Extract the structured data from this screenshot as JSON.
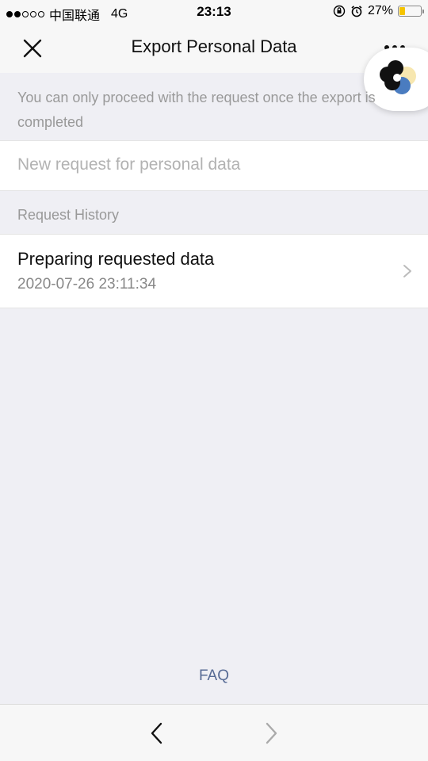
{
  "status_bar": {
    "carrier": "中国联通",
    "network": "4G",
    "time": "23:13",
    "battery_percent": "27%",
    "battery_level": 0.27,
    "battery_color": "#f5c400",
    "signal_bars_filled": 2,
    "signal_bars_total": 5
  },
  "nav": {
    "title": "Export Personal Data",
    "close_icon": "close-icon",
    "more_icon": "more-icon"
  },
  "notice": {
    "text": "You can only proceed with the request once the export is completed"
  },
  "new_request": {
    "placeholder": "New request for personal data"
  },
  "history": {
    "header": "Request History",
    "items": [
      {
        "title": "Preparing requested data",
        "timestamp": "2020-07-26 23:11:34"
      }
    ]
  },
  "footer": {
    "faq_label": "FAQ",
    "link_color": "#576b95"
  },
  "toolbar": {
    "back_icon": "chevron-left-icon",
    "forward_icon": "chevron-right-icon"
  }
}
